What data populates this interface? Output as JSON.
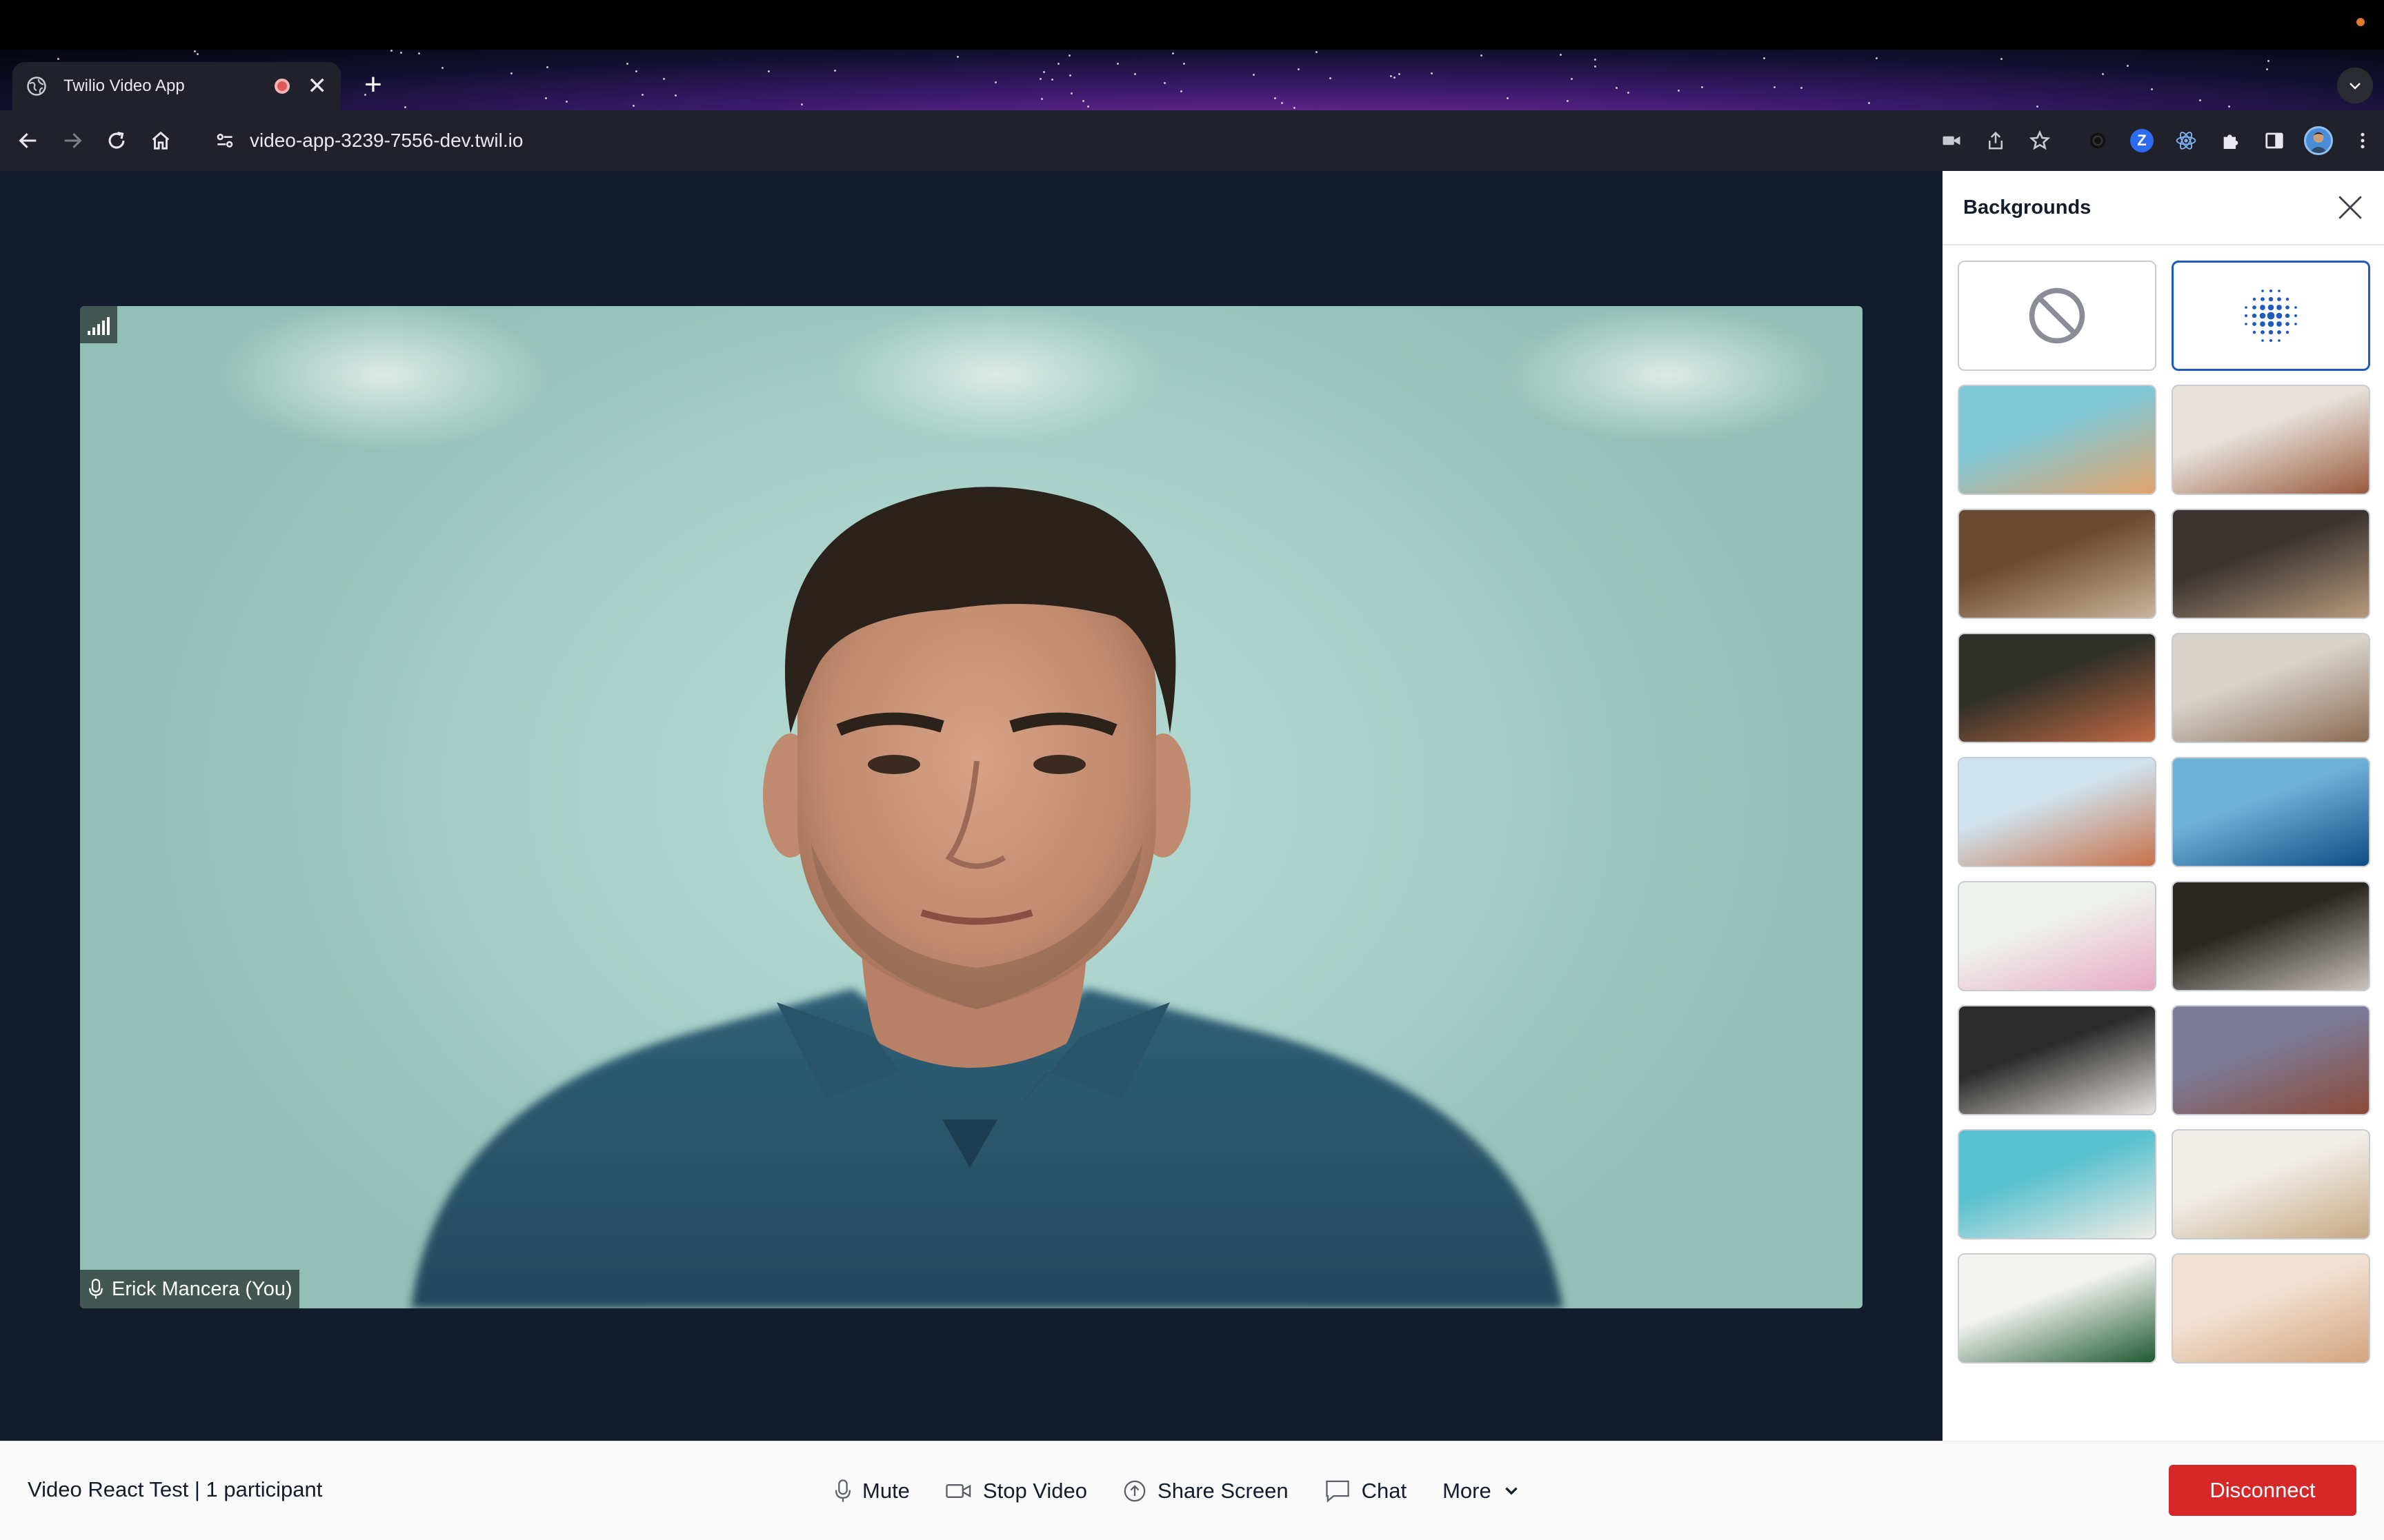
{
  "browser": {
    "tab_title": "Twilio Video App",
    "url": "video-app-3239-7556-dev.twil.io",
    "new_tab_icon": "plus-icon",
    "toolbar_icons": [
      "camera-icon",
      "share-icon",
      "bookmark-star-icon",
      "extension-dark-icon",
      "zoom-extension-icon",
      "react-devtools-icon",
      "puzzle-extensions-icon",
      "side-panel-icon",
      "profile-avatar-icon",
      "kebab-menu-icon"
    ],
    "zoom_letter": "Z"
  },
  "video": {
    "participant_label": "Erick Mancera (You)"
  },
  "panel": {
    "title": "Backgrounds",
    "options": [
      {
        "name": "none",
        "selected": false
      },
      {
        "name": "blur",
        "selected": true
      }
    ],
    "images": [
      {
        "name": "abstract-smoke",
        "colors": [
          "#7fc7d6",
          "#e2a36a"
        ]
      },
      {
        "name": "living-room",
        "colors": [
          "#e6e1da",
          "#9a5a3c"
        ]
      },
      {
        "name": "bookshelf",
        "colors": [
          "#6b4a32",
          "#c9b49a"
        ]
      },
      {
        "name": "coffee-shop",
        "colors": [
          "#3b3430",
          "#b79a7c"
        ]
      },
      {
        "name": "lounge-dark",
        "colors": [
          "#2f3028",
          "#c26a44"
        ]
      },
      {
        "name": "modern-living",
        "colors": [
          "#d8d4cc",
          "#8b6a52"
        ]
      },
      {
        "name": "desert-dune",
        "colors": [
          "#cfe3ee",
          "#c8714a"
        ]
      },
      {
        "name": "ocean-boat",
        "colors": [
          "#6fb2d8",
          "#0f4d86"
        ]
      },
      {
        "name": "pink-flowers",
        "colors": [
          "#eef2ec",
          "#e8a9c4"
        ]
      },
      {
        "name": "kitchen-dark",
        "colors": [
          "#2a2622",
          "#c9c4bc"
        ]
      },
      {
        "name": "loft-interior",
        "colors": [
          "#2b2b2b",
          "#e7e4df"
        ]
      },
      {
        "name": "red-rocks",
        "colors": [
          "#7c7c98",
          "#8c4a38"
        ]
      },
      {
        "name": "beach-aerial",
        "colors": [
          "#58c1cf",
          "#f1ece4"
        ]
      },
      {
        "name": "white-dining",
        "colors": [
          "#f2efea",
          "#c7a983"
        ]
      },
      {
        "name": "monstera-leaf",
        "colors": [
          "#f3f3f0",
          "#1f5a32"
        ]
      },
      {
        "name": "golden-gate",
        "colors": [
          "#f2e2d4",
          "#d4a47e"
        ]
      }
    ]
  },
  "footer": {
    "room_info": "Video React Test | 1 participant",
    "mute_label": "Mute",
    "stop_video_label": "Stop Video",
    "share_screen_label": "Share Screen",
    "chat_label": "Chat",
    "more_label": "More",
    "disconnect_label": "Disconnect",
    "colors": {
      "disconnect": "#d62828",
      "stage": "#121c2d",
      "selected_border": "#1f5bbf"
    }
  }
}
